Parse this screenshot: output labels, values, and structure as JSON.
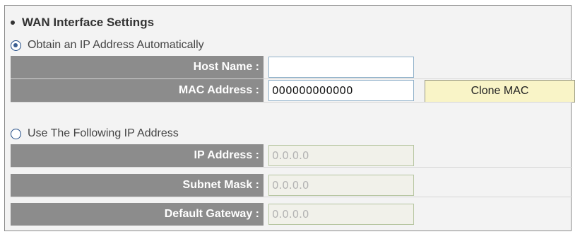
{
  "section": {
    "title": "WAN Interface Settings"
  },
  "auto": {
    "label": "Obtain an IP Address Automatically",
    "selected": true,
    "fields": [
      {
        "label": "Host Name :",
        "value": ""
      },
      {
        "label": "MAC Address :",
        "value": "000000000000"
      }
    ],
    "clone_button_label": "Clone MAC"
  },
  "static": {
    "label": "Use The Following IP Address",
    "selected": false,
    "fields": [
      {
        "label": "IP Address :",
        "value": "0.0.0.0"
      },
      {
        "label": "Subnet Mask :",
        "value": "0.0.0.0"
      },
      {
        "label": "Default Gateway :",
        "value": "0.0.0.0"
      }
    ]
  },
  "colors": {
    "label_bg": "#8c8c8c",
    "button_bg": "#f9f4c7",
    "panel_bg": "#f3f3f3",
    "disabled_input_bg": "#f1f1ea"
  }
}
